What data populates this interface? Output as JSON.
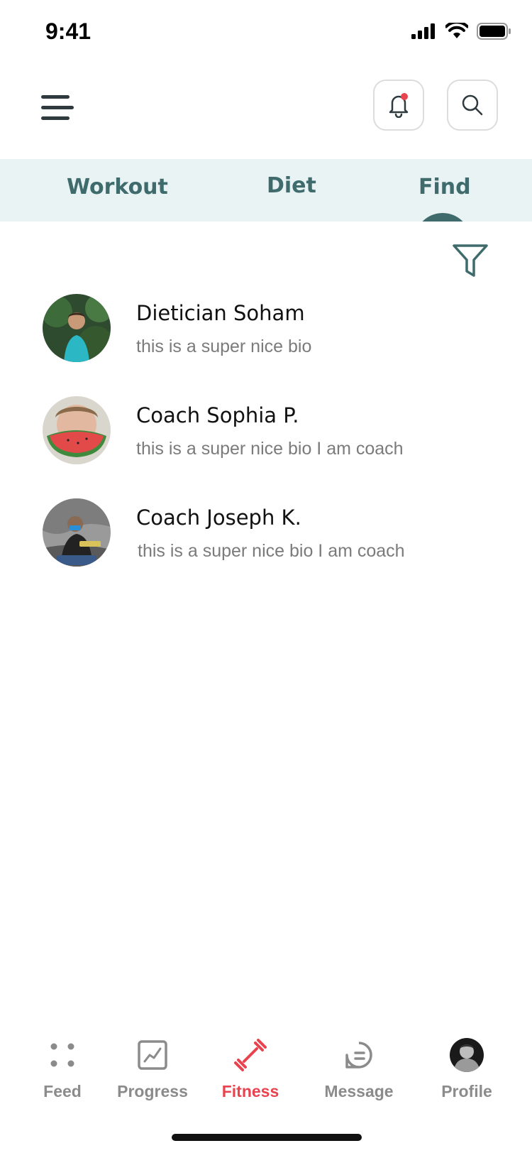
{
  "status_bar": {
    "time": "9:41"
  },
  "header": {
    "menu_icon": "hamburger-menu-icon",
    "notification_icon": "bell-icon",
    "search_icon": "search-icon",
    "notification_dot_color": "#e8434e"
  },
  "tabs": [
    {
      "label": "Workout",
      "active": false
    },
    {
      "label": "Diet",
      "active": false
    },
    {
      "label": "Find",
      "active": true
    }
  ],
  "filter_icon": "filter-icon",
  "coaches": [
    {
      "name": "Dietician Soham",
      "bio": "this is a super nice bio"
    },
    {
      "name": "Coach Sophia P.",
      "bio": "this is a super nice bio I am coach"
    },
    {
      "name": "Coach Joseph K.",
      "bio": "this is a super nice bio I am coach"
    }
  ],
  "bottom_nav": [
    {
      "label": "Feed",
      "icon": "dots-grid-icon",
      "active": false
    },
    {
      "label": "Progress",
      "icon": "chart-icon",
      "active": false
    },
    {
      "label": "Fitness",
      "icon": "dumbbell-icon",
      "active": true
    },
    {
      "label": "Message",
      "icon": "chat-bubble-icon",
      "active": false
    },
    {
      "label": "Profile",
      "icon": "avatar",
      "active": false
    }
  ],
  "colors": {
    "accent": "#e8434e",
    "teal": "#3f6b6d",
    "tab_bg": "#e9f3f4",
    "muted": "#8b8b8b"
  }
}
